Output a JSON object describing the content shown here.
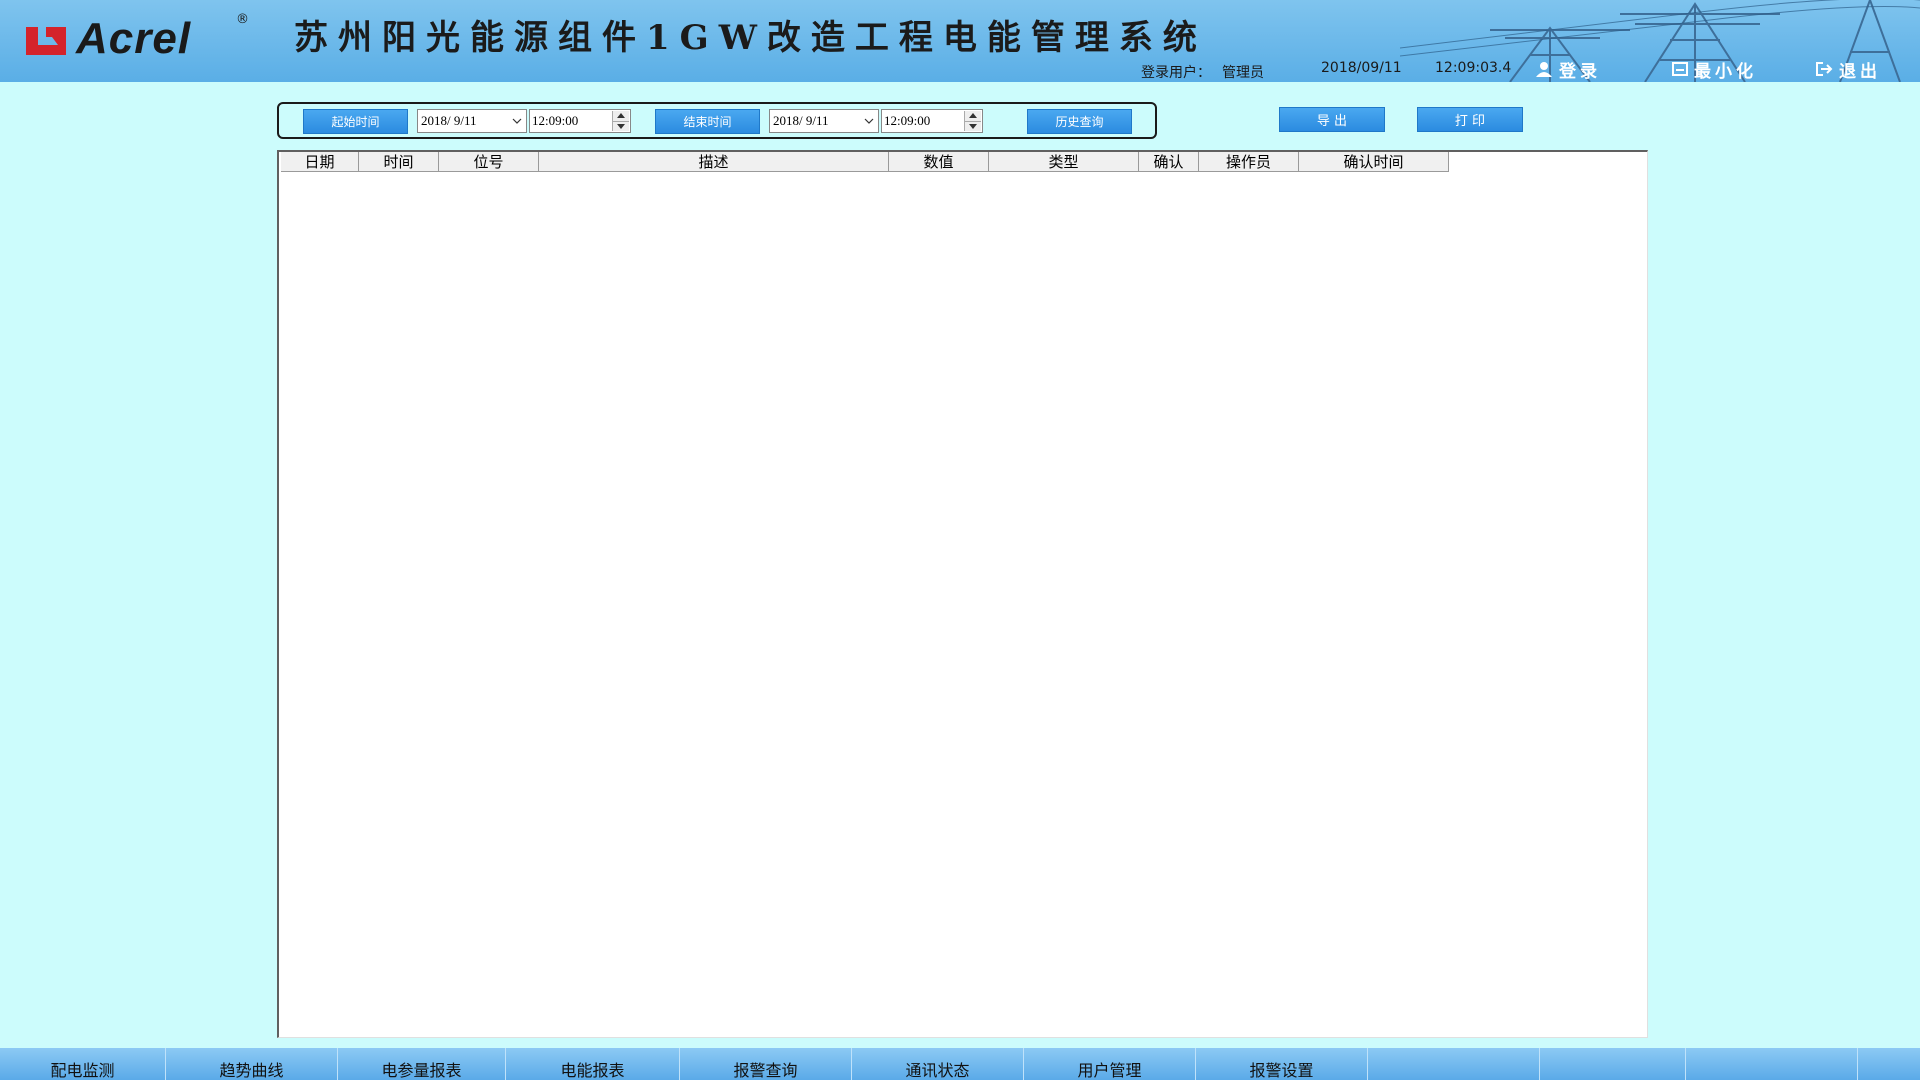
{
  "header": {
    "logo_text": "Acrel",
    "logo_reg": "®",
    "title": "苏州阳光能源组件1GW改造工程电能管理系统",
    "user_label": "登录用户：",
    "user_name": "管理员",
    "date": "2018/09/11",
    "time": "12:09:03.4",
    "login_label": "登录",
    "minimize_label": "最小化",
    "exit_label": "退出"
  },
  "query": {
    "start_button": "起始时间",
    "start_date": "2018/ 9/11",
    "start_time": "12:09:00",
    "end_button": "结束时间",
    "end_date": "2018/ 9/11",
    "end_time": "12:09:00",
    "history_button": "历史查询",
    "export_button": "导 出",
    "print_button": "打 印"
  },
  "table": {
    "columns": [
      "日期",
      "时间",
      "位号",
      "描述",
      "数值",
      "类型",
      "确认",
      "操作员",
      "确认时间"
    ],
    "rows": []
  },
  "nav": {
    "items": [
      "配电监测",
      "趋势曲线",
      "电参量报表",
      "电能报表",
      "报警查询",
      "通讯状态",
      "用户管理",
      "报警设置",
      "",
      "",
      "",
      ""
    ]
  },
  "colors": {
    "background": "#ccfcfc",
    "header": "#6cb8ea",
    "button": "#2b8be0"
  }
}
